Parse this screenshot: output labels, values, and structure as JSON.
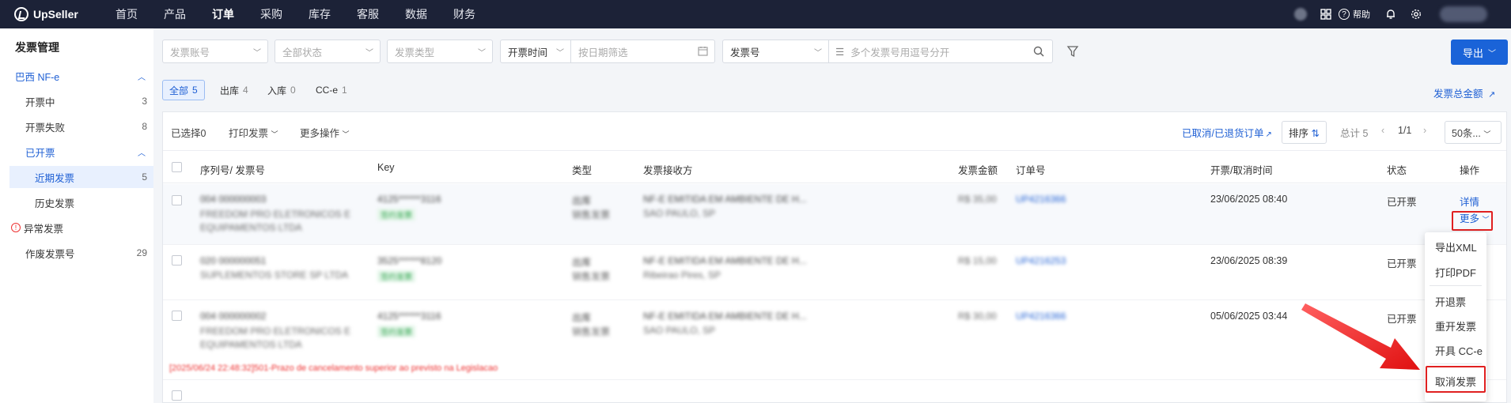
{
  "app": {
    "name": "UpSeller"
  },
  "nav": {
    "items": [
      "首页",
      "产品",
      "订单",
      "采购",
      "库存",
      "客服",
      "数据",
      "财务"
    ],
    "active": "订单"
  },
  "topbar": {
    "help_label": "帮助"
  },
  "sidebar": {
    "title": "发票管理",
    "group_brazil": "巴西 NF-e",
    "items": [
      {
        "label": "开票中",
        "count": "3"
      },
      {
        "label": "开票失败",
        "count": "8"
      }
    ],
    "group_issued": "已开票",
    "issued_items": [
      {
        "label": "近期发票",
        "count": "5"
      },
      {
        "label": "历史发票",
        "count": ""
      }
    ],
    "abnormal": "异常发票",
    "voided": {
      "label": "作废发票号",
      "count": "29"
    }
  },
  "filters": {
    "account_placeholder": "发票账号",
    "status_placeholder": "全部状态",
    "type_placeholder": "发票类型",
    "time_label": "开票时间",
    "date_placeholder": "按日期筛选",
    "invoice_no_label": "发票号",
    "invoice_no_placeholder": "多个发票号用逗号分开",
    "export_label": "导出"
  },
  "tabs": [
    {
      "label": "全部",
      "count": "5"
    },
    {
      "label": "出库",
      "count": "4"
    },
    {
      "label": "入库",
      "count": "0"
    },
    {
      "label": "CC-e",
      "count": "1"
    }
  ],
  "total_amount_link": "发票总金额",
  "toolbar": {
    "selected_label": "已选择",
    "selected_count": "0",
    "print_label": "打印发票",
    "more_ops_label": "更多操作",
    "cancelled_link": "已取消/已退货订单",
    "sort_label": "排序",
    "total_label": "总计 5",
    "page": "1/1",
    "page_size": "50条..."
  },
  "table": {
    "headers": {
      "serial": "序列号/ 发票号",
      "key": "Key",
      "type": "类型",
      "recipient": "发票接收方",
      "amount": "发票金额",
      "order": "订单号",
      "time": "开票/取消时间",
      "status": "状态",
      "actions": "操作"
    },
    "rows": [
      {
        "serial": "004 000000003",
        "company": "FREEDOM PRO ELETRONICOS E EQUIPAMENTOS LTDA",
        "key": "4125******3116",
        "tag": "签约发票",
        "type": "出库",
        "type2": "销售发票",
        "recipient": "NF-E EMITIDA EM AMBIENTE DE H...",
        "city": "SAO PAULO, SP",
        "amount": "R$ 35,00",
        "order": "UP4216366",
        "time": "23/06/2025 08:40",
        "status": "已开票",
        "detail": "详情",
        "more": "更多"
      },
      {
        "serial": "020 000000051",
        "company": "SUPLEMENTOS STORE SP LTDA",
        "key": "3525******8120",
        "tag": "签约发票",
        "type": "出库",
        "type2": "销售发票",
        "recipient": "NF-E EMITIDA EM AMBIENTE DE H...",
        "city": "Ribeirao Pires, SP",
        "amount": "R$ 15,00",
        "order": "UP4216253",
        "time": "23/06/2025 08:39",
        "status": "已开票"
      },
      {
        "serial": "004 000000002",
        "company": "FREEDOM PRO ELETRONICOS E EQUIPAMENTOS LTDA",
        "key": "4125******3116",
        "tag": "签约发票",
        "type": "出库",
        "type2": "销售发票",
        "recipient": "NF-E EMITIDA EM AMBIENTE DE H...",
        "city": "SAO PAULO, SP",
        "amount": "R$ 30,00",
        "order": "UP4216366",
        "time": "05/06/2025 03:44",
        "status": "已开票",
        "error": "[2025/06/24 22:48:32]501-Prazo de cancelamento superior ao previsto na Legislacao"
      }
    ]
  },
  "dropdown": {
    "items": [
      "导出XML",
      "打印PDF",
      "开退票",
      "重开发票",
      "开具 CC-e",
      "取消发票"
    ]
  },
  "colors": {
    "primary": "#1a63d8",
    "nav_bg": "#1c2237",
    "highlight": "#e02020"
  }
}
